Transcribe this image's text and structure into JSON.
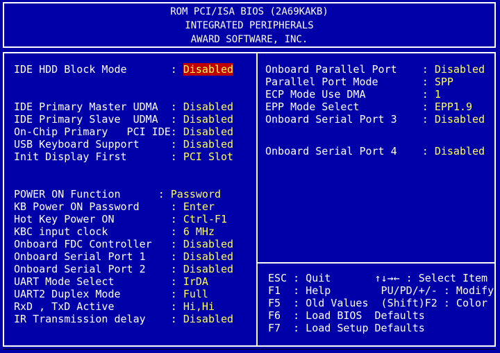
{
  "header": {
    "line1": "ROM PCI/ISA BIOS (2A69KAKB)",
    "line2": "INTEGRATED PERIPHERALS",
    "line3": "AWARD SOFTWARE, INC."
  },
  "left_top": [
    {
      "label": "IDE HDD Block Mode       : ",
      "value": "Disabled",
      "selected": true
    }
  ],
  "left_mid": [
    {
      "label": "IDE Primary Master UDMA  : ",
      "value": "Disabled"
    },
    {
      "label": "IDE Primary Slave  UDMA  : ",
      "value": "Disabled"
    },
    {
      "label": "On-Chip Primary   PCI IDE: ",
      "value": "Disabled"
    },
    {
      "label": "USB Keyboard Support     : ",
      "value": "Disabled"
    },
    {
      "label": "Init Display First       : ",
      "value": "PCI Slot"
    }
  ],
  "left_bot": [
    {
      "label": "POWER ON Function      : ",
      "value": "Password"
    },
    {
      "label": "KB Power ON Password     : ",
      "value": "Enter"
    },
    {
      "label": "Hot Key Power ON         : ",
      "value": "Ctrl-F1"
    },
    {
      "label": "KBC input clock          : ",
      "value": "6 MHz"
    },
    {
      "label": "Onboard FDC Controller   : ",
      "value": "Disabled"
    },
    {
      "label": "Onboard Serial Port 1    : ",
      "value": "Disabled"
    },
    {
      "label": "Onboard Serial Port 2    : ",
      "value": "Disabled"
    },
    {
      "label": "UART Mode Select         : ",
      "value": "IrDA"
    },
    {
      "label": "UART2 Duplex Mode        : ",
      "value": "Full"
    },
    {
      "label": "RxD , TxD Active         : ",
      "value": "Hi,Hi"
    },
    {
      "label": "IR Transmission delay    : ",
      "value": "Disabled"
    }
  ],
  "right_top": [
    {
      "label": "Onboard Parallel Port    : ",
      "value": "Disabled"
    },
    {
      "label": "Parallel Port Mode       : ",
      "value": "SPP"
    },
    {
      "label": "ECP Mode Use DMA         : ",
      "value": "1"
    },
    {
      "label": "EPP Mode Select          : ",
      "value": "EPP1.9"
    },
    {
      "label": "Onboard Serial Port 3    : ",
      "value": "Disabled"
    }
  ],
  "right_mid": [
    {
      "label": "Onboard Serial Port 4    : ",
      "value": "Disabled"
    }
  ],
  "help": [
    "ESC : Quit       ↑↓→← : Select Item",
    "F1  : Help        PU/PD/+/- : Modify",
    "F5  : Old Values  (Shift)F2 : Color",
    "F6  : Load BIOS  Defaults",
    "F7  : Load Setup Defaults"
  ],
  "colors": {
    "background": "#0000a8",
    "label": "#ffffff",
    "value": "#ffff55",
    "highlight": "#c00000"
  }
}
